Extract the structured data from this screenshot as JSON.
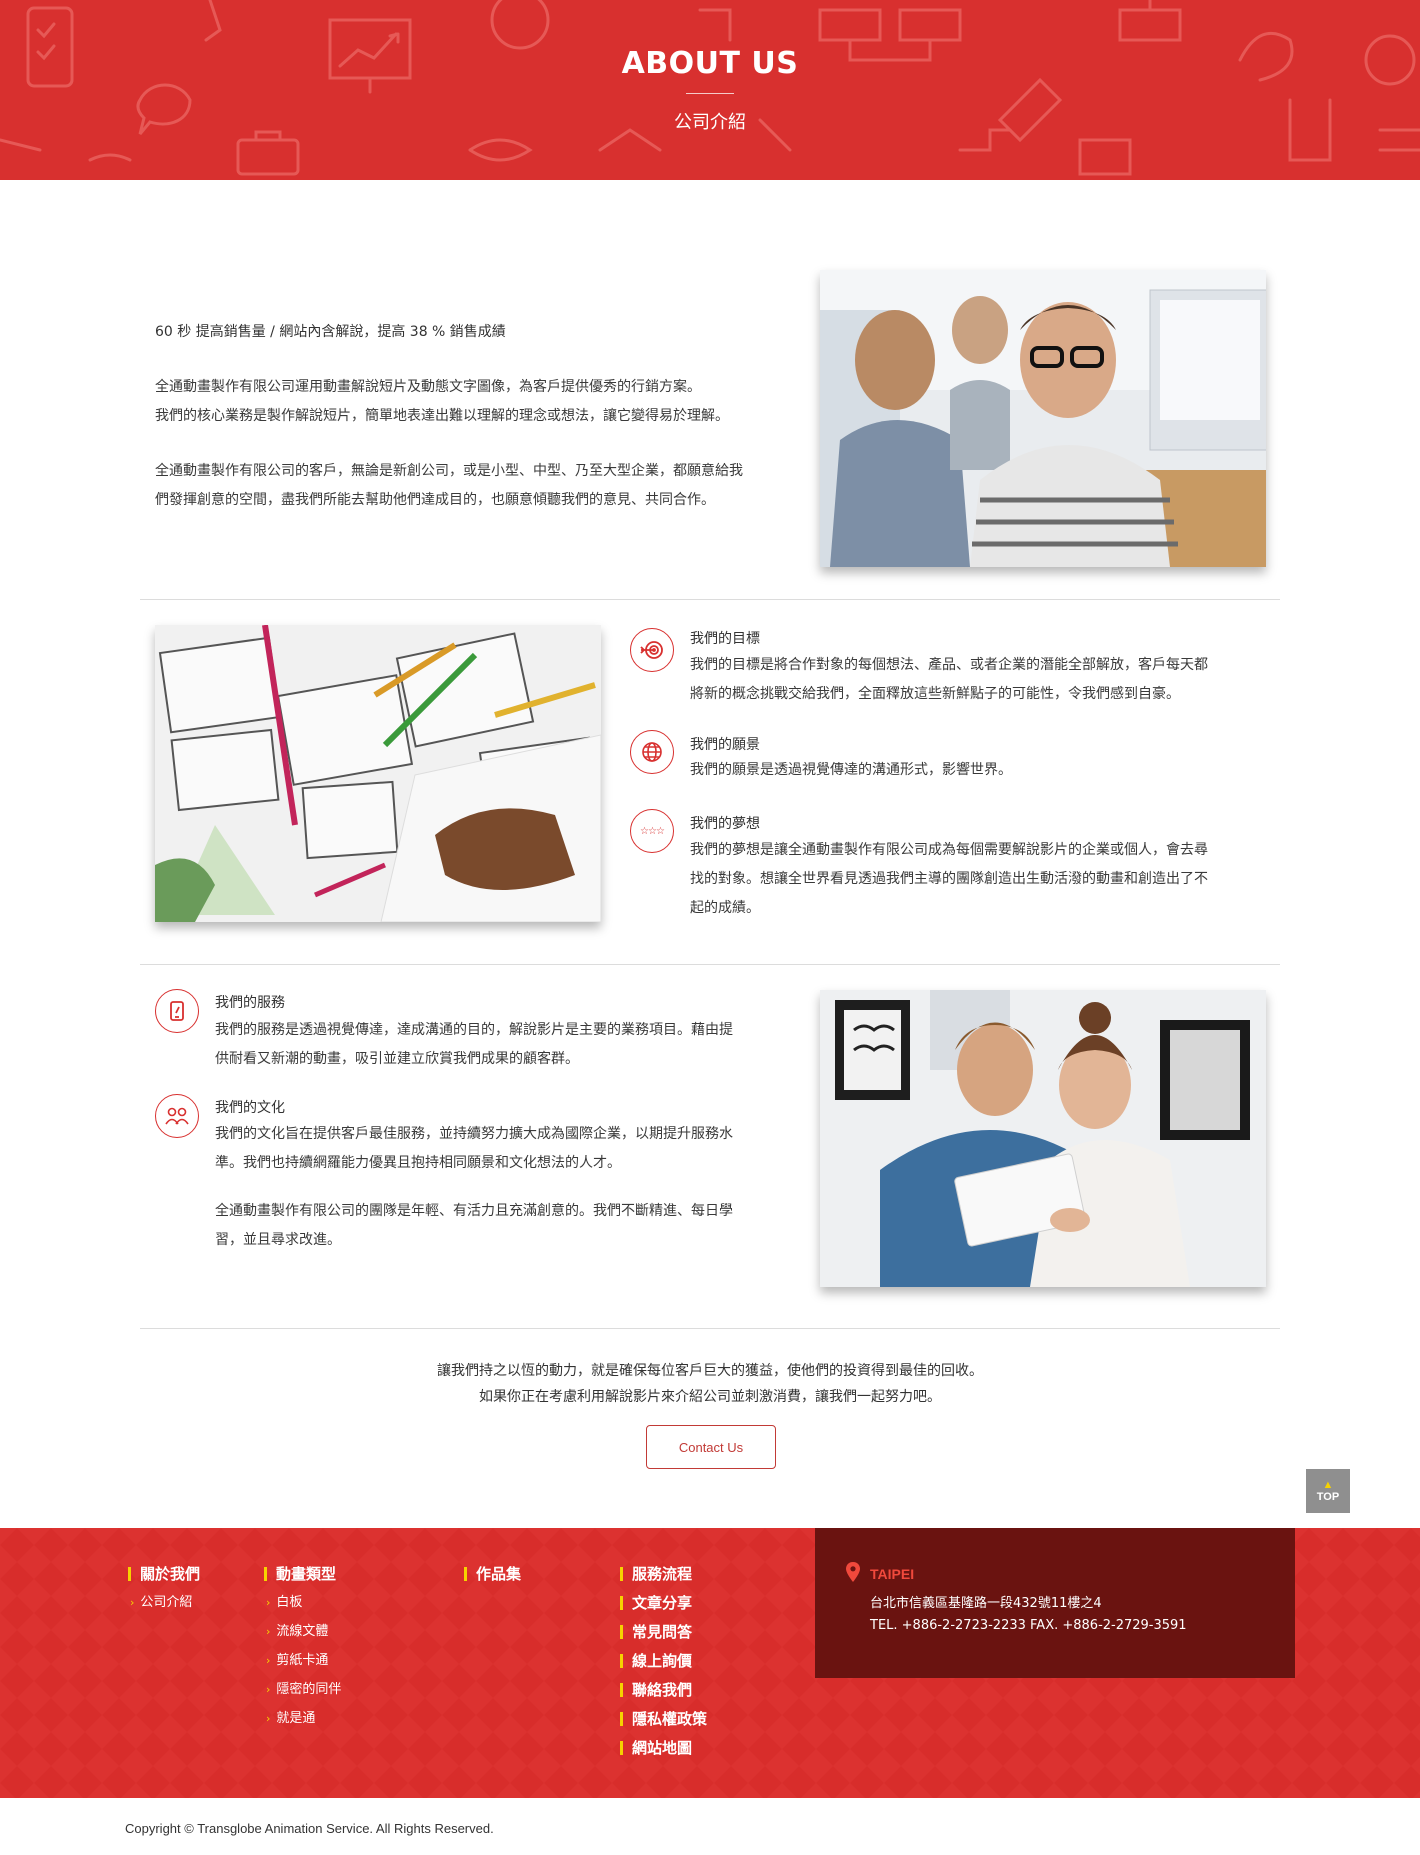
{
  "hero": {
    "title": "ABOUT US",
    "subtitle": "公司介紹"
  },
  "intro": {
    "tagline": "60 秒 提高銷售量 / 網站內含解說，提高 38 % 銷售成績",
    "paragraph1_line1": "全通動畫製作有限公司運用動畫解說短片及動態文字圖像，為客戶提供優秀的行銷方案。",
    "paragraph1_line2": "我們的核心業務是製作解說短片，簡單地表達出難以理解的理念或想法，讓它變得易於理解。",
    "paragraph2_line1": "全通動畫製作有限公司的客戶，無論是新創公司，或是小型、中型、乃至大型企業，都願意給我",
    "paragraph2_line2": "們發揮創意的空間，盡我們所能去幫助他們達成目的，也願意傾聽我們的意見、共同合作。"
  },
  "features": [
    {
      "icon": "target-icon",
      "title": "我們的目標",
      "lines": [
        "我們的目標是將合作對象的每個想法、產品、或者企業的潛能全部解放，客戶每天都",
        "將新的概念挑戰交給我們，全面釋放這些新鮮點子的可能性，令我們感到自豪。"
      ]
    },
    {
      "icon": "globe-icon",
      "title": "我們的願景",
      "lines": [
        "我們的願景是透過視覺傳達的溝通形式，影響世界。"
      ]
    },
    {
      "icon": "stars-icon",
      "title": "我們的夢想",
      "lines": [
        "我們的夢想是讓全通動畫製作有限公司成為每個需要解說影片的企業或個人，會去尋",
        "找的對象。想讓全世界看見透過我們主導的團隊創造出生動活潑的動畫和創造出了不",
        "起的成績。"
      ]
    },
    {
      "icon": "tablet-icon",
      "title": "我們的服務",
      "lines": [
        "我們的服務是透過視覺傳達，達成溝通的目的，解說影片是主要的業務項目。藉由提",
        "供耐看又新潮的動畫，吸引並建立欣賞我們成果的顧客群。"
      ]
    },
    {
      "icon": "team-icon",
      "title": "我們的文化",
      "lines": [
        "我們的文化旨在提供客戶最佳服務，並持續努力擴大成為國際企業，以期提升服務水",
        "準。我們也持續網羅能力優異且抱持相同願景和文化想法的人才。"
      ]
    }
  ],
  "culture_extra": {
    "line1": "全通動畫製作有限公司的團隊是年輕、有活力且充滿創意的。我們不斷精進、每日學",
    "line2": "習，並且尋求改進。"
  },
  "closing": {
    "line1": "讓我們持之以恆的動力，就是確保每位客戶巨大的獲益，使他們的投資得到最佳的回收。",
    "line2": "如果你正在考慮利用解說影片來介紹公司並刺激消費，讓我們一起努力吧。",
    "button": "Contact Us"
  },
  "top_button": "TOP",
  "footer": {
    "col1": {
      "head": "關於我們",
      "items": [
        "公司介紹"
      ]
    },
    "col2": {
      "head": "動畫類型",
      "items": [
        "白板",
        "流線文體",
        "剪紙卡通",
        "隱密的同伴",
        "就是通"
      ]
    },
    "col3": {
      "head": "作品集"
    },
    "col4": [
      "服務流程",
      "文章分享",
      "常見問答",
      "線上詢價",
      "聯絡我們",
      "隱私權政策",
      "網站地圖"
    ],
    "city": "TAIPEI",
    "address": "台北市信義區基隆路一段432號11樓之4",
    "phone": "TEL. +886-2-2723-2233 FAX. +886-2-2729-3591"
  },
  "copyright": "Copyright © Transglobe Animation Service.   All Rights Reserved.",
  "colors": {
    "brand_red": "#d8302f",
    "footer_dark": "#6a1310",
    "accent_yellow": "#f6d200"
  }
}
